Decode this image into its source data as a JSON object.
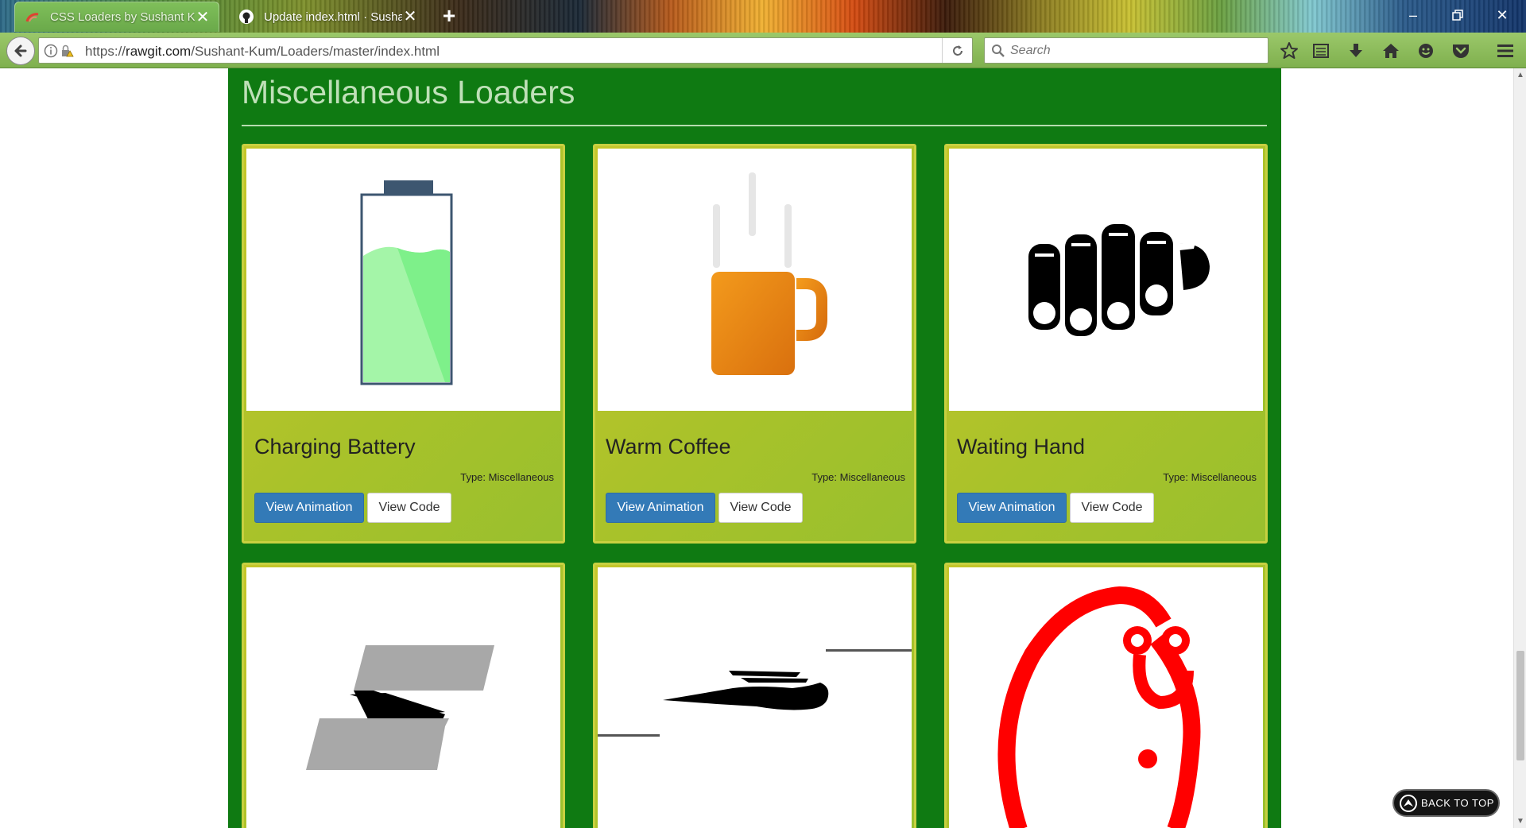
{
  "browser": {
    "tabs": [
      {
        "title": "CSS Loaders by Sushant K...",
        "favicon": "rawgit-icon",
        "active": true
      },
      {
        "title": "Update index.html · Susha...",
        "favicon": "github-icon",
        "active": false
      }
    ],
    "url_prefix": "https://",
    "url_domain": "rawgit.com",
    "url_path": "/Sushant-Kum/Loaders/master/index.html",
    "search_placeholder": "Search"
  },
  "page": {
    "section_title": "Miscellaneous Loaders",
    "cards": [
      {
        "name": "Charging Battery",
        "type": "Type: Miscellaneous",
        "view_animation": "View Animation",
        "view_code": "View Code"
      },
      {
        "name": "Warm Coffee",
        "type": "Type: Miscellaneous",
        "view_animation": "View Animation",
        "view_code": "View Code"
      },
      {
        "name": "Waiting Hand",
        "type": "Type: Miscellaneous",
        "view_animation": "View Animation",
        "view_code": "View Code"
      }
    ],
    "back_to_top": "BACK TO TOP"
  },
  "colors": {
    "container_green": "#0f7a12",
    "card_yellow": "#c5c62a",
    "primary_button": "#337ab7",
    "battery_fill": "#7ef08a",
    "coffee_orange": "#e98a14",
    "loader_red": "#ff0000"
  }
}
